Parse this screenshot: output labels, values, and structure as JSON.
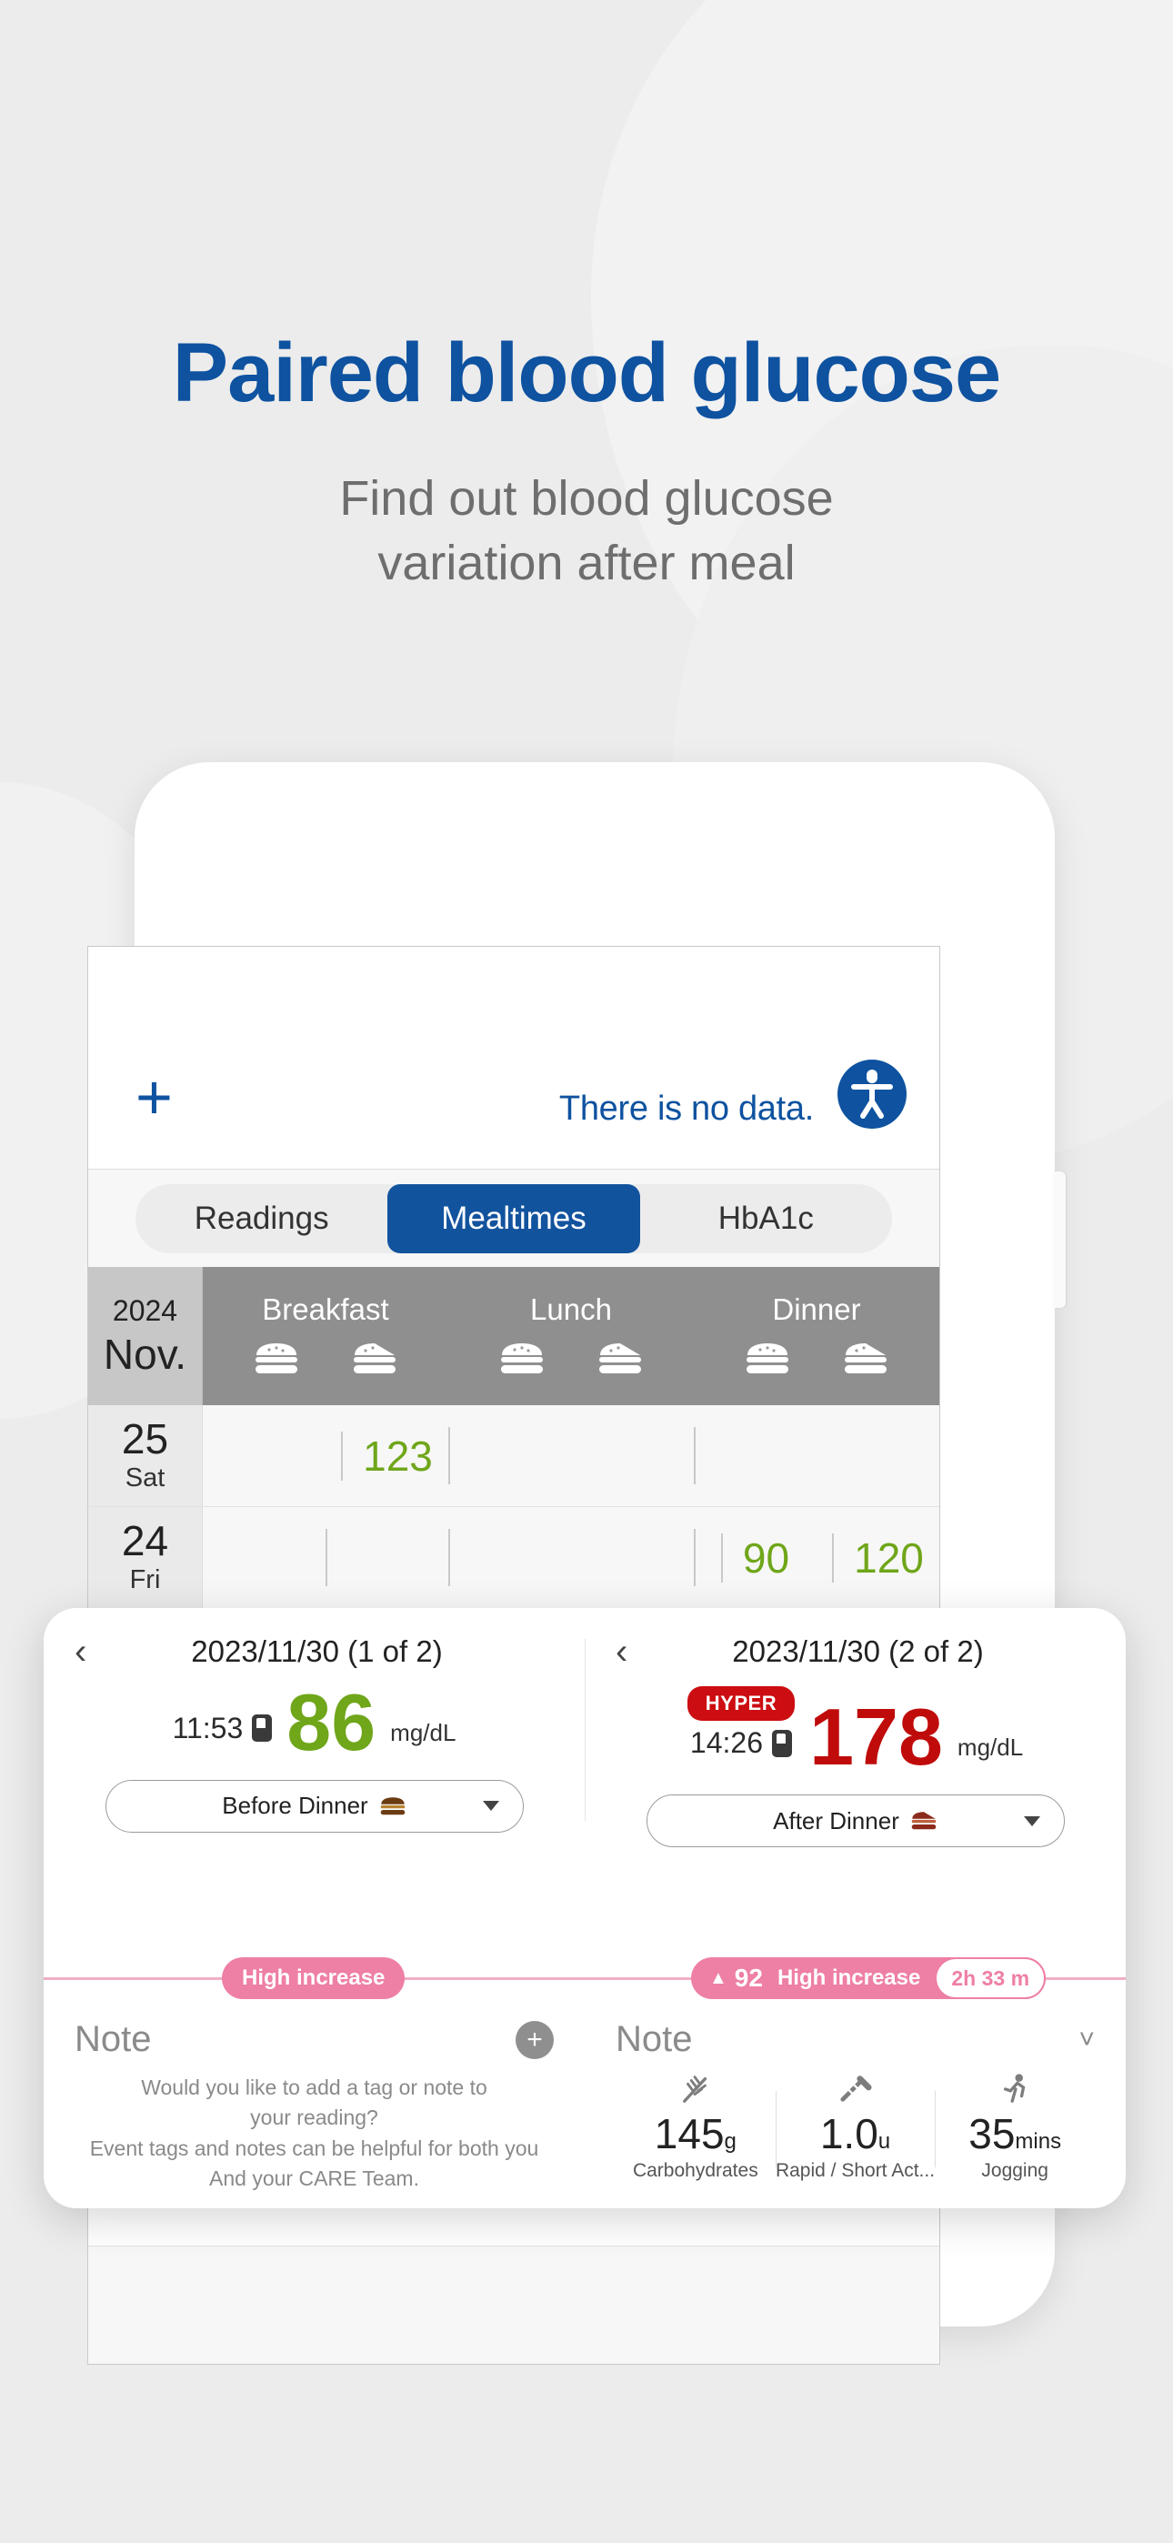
{
  "hero": {
    "title": "Paired blood glucose",
    "subtitle_line1": "Find out blood glucose",
    "subtitle_line2": "variation after meal",
    "title_color": "#0E52A0",
    "subtitle_color": "#6E6E6E"
  },
  "app": {
    "topbar": {
      "add_label": "+",
      "no_data_label": "There is no data.",
      "accessibility_icon": "accessibility-icon"
    },
    "tabs": [
      {
        "label": "Readings",
        "active": false
      },
      {
        "label": "Mealtimes",
        "active": true
      },
      {
        "label": "HbA1c",
        "active": false
      }
    ],
    "table": {
      "month_year": "2024",
      "month_name": "Nov.",
      "meal_columns": [
        "Breakfast",
        "Lunch",
        "Dinner"
      ],
      "rows": [
        {
          "day": "25",
          "weekday": "Sat",
          "values": [
            "",
            "123",
            "",
            "",
            "",
            ""
          ]
        },
        {
          "day": "24",
          "weekday": "Fri",
          "values": [
            "",
            "",
            "",
            "",
            "90",
            "120"
          ]
        }
      ]
    }
  },
  "detail": {
    "left": {
      "back_icon": "chevron-left-icon",
      "date_label": "2023/11/30  (1 of 2)",
      "time": "11:53",
      "value": "86",
      "unit": "mg/dL",
      "value_color": "#6FA61A",
      "status_badge": "",
      "meal_tag": "Before Dinner",
      "note_title": "Note",
      "note_hint_line1": "Would you like to add a tag or note to",
      "note_hint_line2": "your reading?",
      "note_hint_line3": "Event tags and notes can be helpful for both you",
      "note_hint_line4": "And your CARE Team.",
      "note_icons": [
        "note-icon",
        "camera-icon",
        "carbs-icon",
        "insulin-icon",
        "activity-icon"
      ],
      "add_note_label": "+"
    },
    "right": {
      "back_icon": "chevron-left-icon",
      "date_label": "2023/11/30  (2 of 2)",
      "time": "14:26",
      "value": "178",
      "unit": "mg/dL",
      "value_color": "#C00B0B",
      "status_badge": "HYPER",
      "meal_tag": "After Dinner",
      "note_title": "Note",
      "nutrition": [
        {
          "icon": "carbs-icon",
          "value": "145",
          "unit": "g",
          "label": "Carbohydrates"
        },
        {
          "icon": "insulin-icon",
          "value": "1.0",
          "unit": "u",
          "label": "Rapid / Short Act..."
        },
        {
          "icon": "activity-icon",
          "value": "35",
          "unit": "mins",
          "label": "Jogging"
        }
      ]
    },
    "trend": {
      "left_pill": "High increase",
      "right_arrow": "▲",
      "right_delta": "92",
      "right_label": "High increase",
      "right_duration": "2h 33 m",
      "pill_color": "#EE7FA5"
    }
  }
}
